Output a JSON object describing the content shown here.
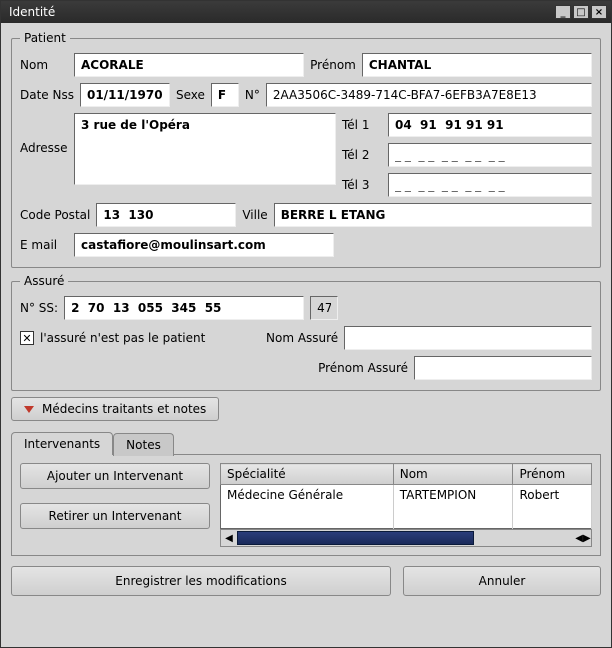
{
  "window": {
    "title": "Identité",
    "min_icon": "_",
    "max_icon": "□",
    "close_icon": "×"
  },
  "patient": {
    "legend": "Patient",
    "labels": {
      "nom": "Nom",
      "prenom": "Prénom",
      "date_nss": "Date Nss",
      "sexe": "Sexe",
      "num": "N°",
      "adresse": "Adresse",
      "tel1": "Tél 1",
      "tel2": "Tél 2",
      "tel3": "Tél 3",
      "code_postal": "Code Postal",
      "ville": "Ville",
      "email": "E mail"
    },
    "values": {
      "nom": "ACORALE",
      "prenom": "CHANTAL",
      "date_nss": "01/11/1970",
      "sexe": "F",
      "num": "2AA3506C-3489-714C-BFA7-6EFB3A7E8E13",
      "adresse": "3 rue de l'Opéra",
      "tel1": "04  91  91 91 91",
      "tel2": "_ _  _ _  _ _  _ _  _ _",
      "tel3": "_ _  _ _  _ _  _ _  _ _",
      "code_postal": "13  130",
      "ville": "BERRE L ETANG",
      "email": "castafiore@moulinsart.com"
    }
  },
  "assure": {
    "legend": "Assuré",
    "labels": {
      "nss": "N° SS:",
      "not_patient": "l'assuré n'est pas le patient",
      "nom_assure": "Nom Assuré",
      "prenom_assure": "Prénom Assuré"
    },
    "values": {
      "nss": "2  70  13  055  345  55",
      "nss_key": "47",
      "not_patient_checked": "✕",
      "nom_assure": "",
      "prenom_assure": ""
    }
  },
  "section_btn": "Médecins traitants et notes",
  "tabs": {
    "intervenants": "Intervenants",
    "notes": "Notes"
  },
  "intervenants": {
    "add_btn": "Ajouter un Intervenant",
    "remove_btn": "Retirer un Intervenant",
    "columns": {
      "specialite": "Spécialité",
      "nom": "Nom",
      "prenom": "Prénom"
    },
    "rows": [
      {
        "specialite": "Médecine Générale",
        "nom": "TARTEMPION",
        "prenom": "Robert"
      }
    ]
  },
  "footer": {
    "save": "Enregistrer les modifications",
    "cancel": "Annuler"
  }
}
